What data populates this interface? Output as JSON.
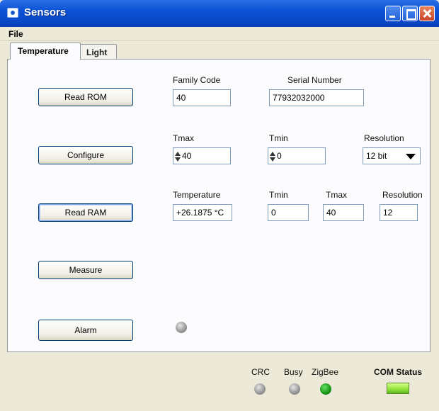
{
  "window": {
    "title": "Sensors"
  },
  "menu": {
    "file": "File"
  },
  "tabs": [
    {
      "label": "Temperature",
      "active": true
    },
    {
      "label": "Light",
      "active": false
    }
  ],
  "rom": {
    "button": "Read ROM",
    "family_code_label": "Family Code",
    "family_code_value": "40",
    "serial_label": "Serial Number",
    "serial_value": "77932032000"
  },
  "configure": {
    "button": "Configure",
    "tmax_label": "Tmax",
    "tmax_value": "40",
    "tmin_label": "Tmin",
    "tmin_value": "0",
    "resolution_label": "Resolution",
    "resolution_value": "12 bit"
  },
  "ram": {
    "button": "Read RAM",
    "temperature_label": "Temperature",
    "temperature_value": "+26.1875  °C",
    "tmin_label": "Tmin",
    "tmin_value": "0",
    "tmax_label": "Tmax",
    "tmax_value": "40",
    "resolution_label": "Resolution",
    "resolution_value": "12"
  },
  "measure": {
    "button": "Measure"
  },
  "alarm": {
    "button": "Alarm"
  },
  "status": {
    "crc_label": "CRC",
    "busy_label": "Busy",
    "zigbee_label": "ZigBee",
    "com_status_label": "COM Status"
  },
  "colors": {
    "led_off": "#9a9a9a",
    "zigbee_led": "#1a9a1a",
    "com_status_led": "#8fe23a"
  }
}
